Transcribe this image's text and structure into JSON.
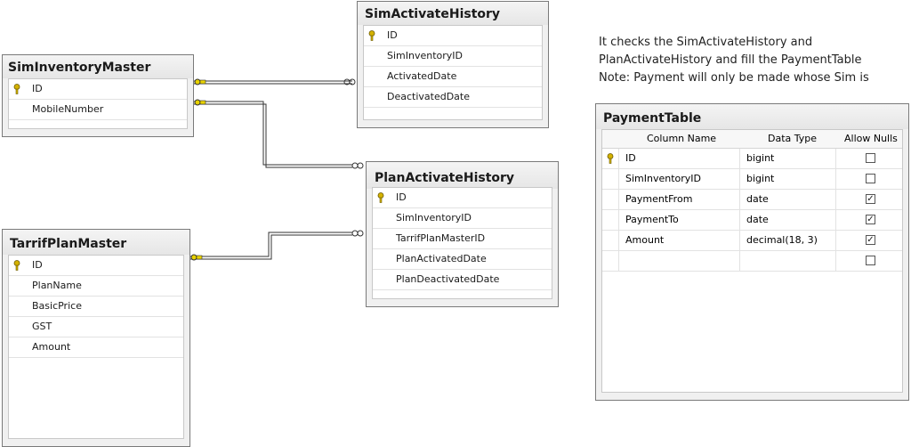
{
  "tables": {
    "sim_inventory_master": {
      "title": "SimInventoryMaster",
      "columns": [
        "ID",
        "MobileNumber"
      ]
    },
    "sim_activate_history": {
      "title": "SimActivateHistory",
      "columns": [
        "ID",
        "SimInventoryID",
        "ActivatedDate",
        "DeactivatedDate"
      ]
    },
    "plan_activate_history": {
      "title": "PlanActivateHistory",
      "columns": [
        "ID",
        "SimInventoryID",
        "TarrifPlanMasterID",
        "PlanActivatedDate",
        "PlanDeactivatedDate"
      ]
    },
    "tarrif_plan_master": {
      "title": "TarrifPlanMaster",
      "columns": [
        "ID",
        "PlanName",
        "BasicPrice",
        "GST",
        "Amount"
      ]
    }
  },
  "note": {
    "line1": "It checks the SimActivateHistory and",
    "line2": "PlanActivateHistory and fill the PaymentTable",
    "line3": "Note: Payment will only be made whose Sim is"
  },
  "payment_table": {
    "title": "PaymentTable",
    "headers": [
      "Column Name",
      "Data Type",
      "Allow Nulls"
    ],
    "rows": [
      {
        "name": "ID",
        "type": "bigint",
        "allow_nulls": false,
        "key": true
      },
      {
        "name": "SimInventoryID",
        "type": "bigint",
        "allow_nulls": false,
        "key": false
      },
      {
        "name": "PaymentFrom",
        "type": "date",
        "allow_nulls": true,
        "key": false
      },
      {
        "name": "PaymentTo",
        "type": "date",
        "allow_nulls": true,
        "key": false
      },
      {
        "name": "Amount",
        "type": "decimal(18, 3)",
        "allow_nulls": true,
        "key": false
      },
      {
        "name": "",
        "type": "",
        "allow_nulls": false,
        "key": false
      }
    ]
  },
  "colors": {
    "key_icon": "#d4b200",
    "connector": "#333333",
    "border": "#7a7a7a"
  }
}
